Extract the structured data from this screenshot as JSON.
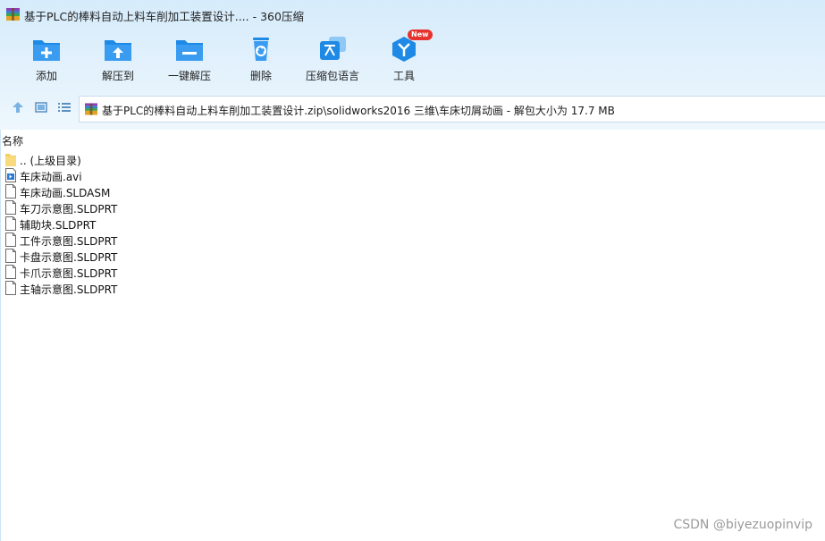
{
  "window": {
    "title": "基于PLC的棒料自动上料车削加工装置设计.... - 360压缩",
    "app_icon": "winrar-archive-icon"
  },
  "toolbar": {
    "items": [
      {
        "label": "添加",
        "icon": "folder-plus-icon"
      },
      {
        "label": "解压到",
        "icon": "folder-upload-icon"
      },
      {
        "label": "一键解压",
        "icon": "folder-minus-icon"
      },
      {
        "label": "删除",
        "icon": "trash-icon"
      },
      {
        "label": "压缩包语言",
        "icon": "translate-icon"
      },
      {
        "label": "工具",
        "icon": "tools-cube-icon",
        "badge": "New"
      }
    ]
  },
  "navigation": {
    "up": "arrow-up-icon",
    "thumbnail_view": "thumbnail-view-icon",
    "list_view": "list-view-icon"
  },
  "address_bar": {
    "path": "基于PLC的棒料自动上料车削加工装置设计.zip\\solidworks2016 三维\\车床切屑动画 - 解包大小为 17.7 MB"
  },
  "file_list": {
    "column_header": "名称",
    "items": [
      {
        "name": ".. (上级目录)",
        "type": "parent-folder"
      },
      {
        "name": "车床动画.avi",
        "type": "video"
      },
      {
        "name": "车床动画.SLDASM",
        "type": "file"
      },
      {
        "name": "车刀示意图.SLDPRT",
        "type": "file"
      },
      {
        "name": "辅助块.SLDPRT",
        "type": "file"
      },
      {
        "name": "工件示意图.SLDPRT",
        "type": "file"
      },
      {
        "name": "卡盘示意图.SLDPRT",
        "type": "file"
      },
      {
        "name": "卡爪示意图.SLDPRT",
        "type": "file"
      },
      {
        "name": "主轴示意图.SLDPRT",
        "type": "file"
      }
    ]
  },
  "watermark": "CSDN @biyezuopinvip",
  "colors": {
    "accent_blue": "#1e8ae6",
    "toolbar_background": "#dcedfb",
    "badge_red": "#e5322e",
    "folder_yellow": "#f3cf60"
  }
}
